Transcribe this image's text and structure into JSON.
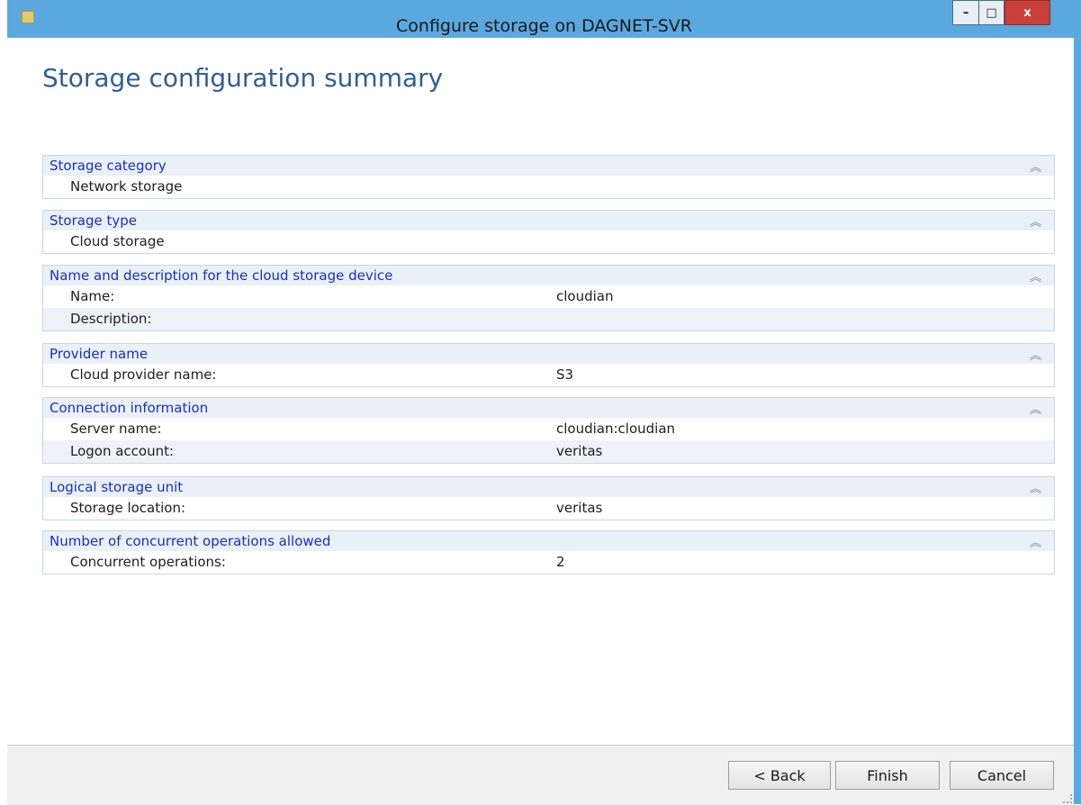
{
  "window": {
    "title": "Configure storage on DAGNET-SVR",
    "controls": {
      "minimize": "–",
      "maximize": "□",
      "close": "x"
    }
  },
  "page": {
    "heading": "Storage configuration summary"
  },
  "sections": [
    {
      "title": "Storage category",
      "rows": [
        {
          "label": "Network storage",
          "value": ""
        }
      ]
    },
    {
      "title": "Storage type",
      "rows": [
        {
          "label": "Cloud storage",
          "value": ""
        }
      ]
    },
    {
      "title": "Name and description for the cloud storage device",
      "rows": [
        {
          "label": "Name:",
          "value": "cloudian"
        },
        {
          "label": "Description:",
          "value": ""
        }
      ]
    },
    {
      "title": "Provider name",
      "rows": [
        {
          "label": "Cloud provider name:",
          "value": "S3"
        }
      ]
    },
    {
      "title": "Connection information",
      "rows": [
        {
          "label": "Server name:",
          "value": "cloudian:cloudian"
        },
        {
          "label": "Logon account:",
          "value": "veritas"
        }
      ]
    },
    {
      "title": "Logical storage unit",
      "rows": [
        {
          "label": "Storage location:",
          "value": "veritas"
        }
      ]
    },
    {
      "title": "Number of concurrent operations allowed",
      "rows": [
        {
          "label": "Concurrent operations:",
          "value": "2"
        }
      ]
    }
  ],
  "icons": {
    "collapse": "chevron-double-up-icon"
  },
  "buttons": {
    "back": "< Back",
    "finish": "Finish",
    "cancel": "Cancel"
  }
}
